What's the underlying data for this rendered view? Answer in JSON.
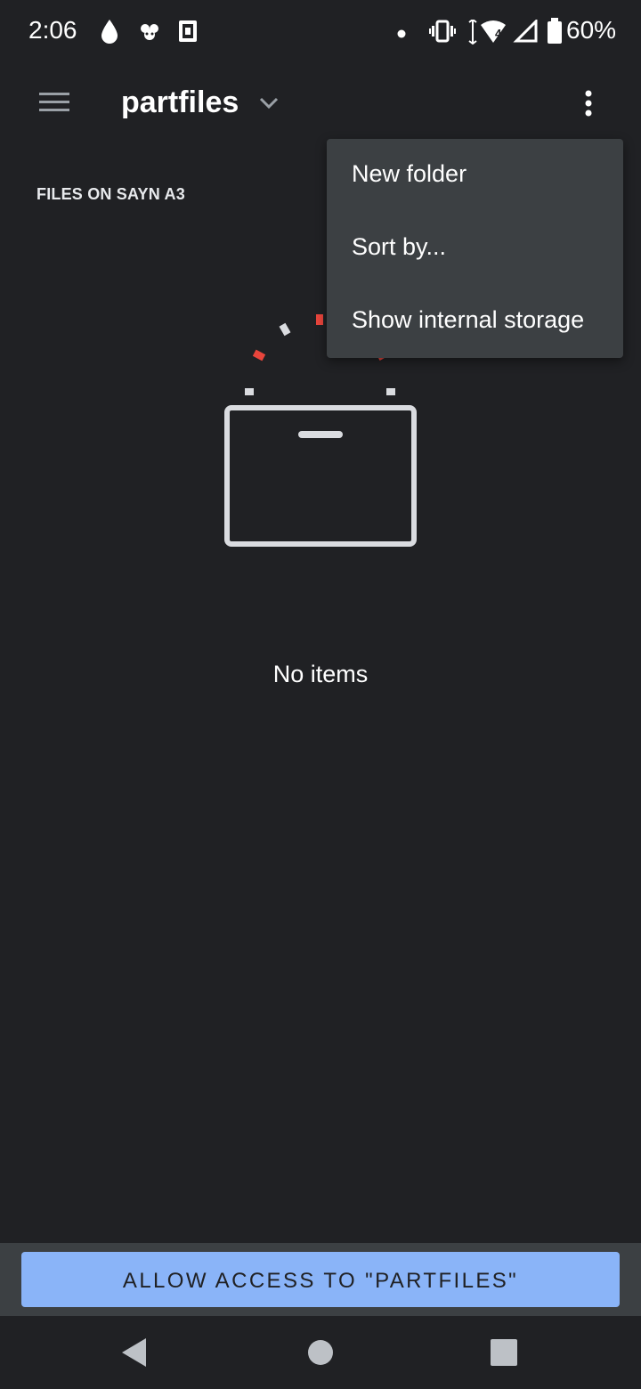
{
  "status_bar": {
    "time": "2:06",
    "battery": "60%",
    "network_badge": "4",
    "icons": [
      "drop-icon",
      "game-icon",
      "app-icon",
      "dot-icon",
      "vibrate-icon",
      "wifi-icon",
      "signal-icon",
      "battery-icon"
    ]
  },
  "toolbar": {
    "title": "partfiles",
    "menu_icon": "hamburger-menu-icon",
    "dropdown_icon": "chevron-down-icon",
    "more_icon": "more-vert-icon"
  },
  "section": {
    "header": "FILES ON SAYN A3"
  },
  "menu": {
    "items": [
      {
        "label": "New folder"
      },
      {
        "label": "Sort by..."
      },
      {
        "label": "Show internal storage"
      }
    ]
  },
  "empty_state": {
    "text": "No items",
    "icon": "empty-folder-illustration"
  },
  "allow_button": {
    "label": "ALLOW ACCESS TO \"PARTFILES\""
  },
  "nav_bar": {
    "icons": [
      "back-icon",
      "home-icon",
      "recents-icon"
    ]
  },
  "colors": {
    "background": "#202124",
    "menu": "#3c4043",
    "accent": "#8ab4f8",
    "illustration_red": "#e8453c"
  }
}
